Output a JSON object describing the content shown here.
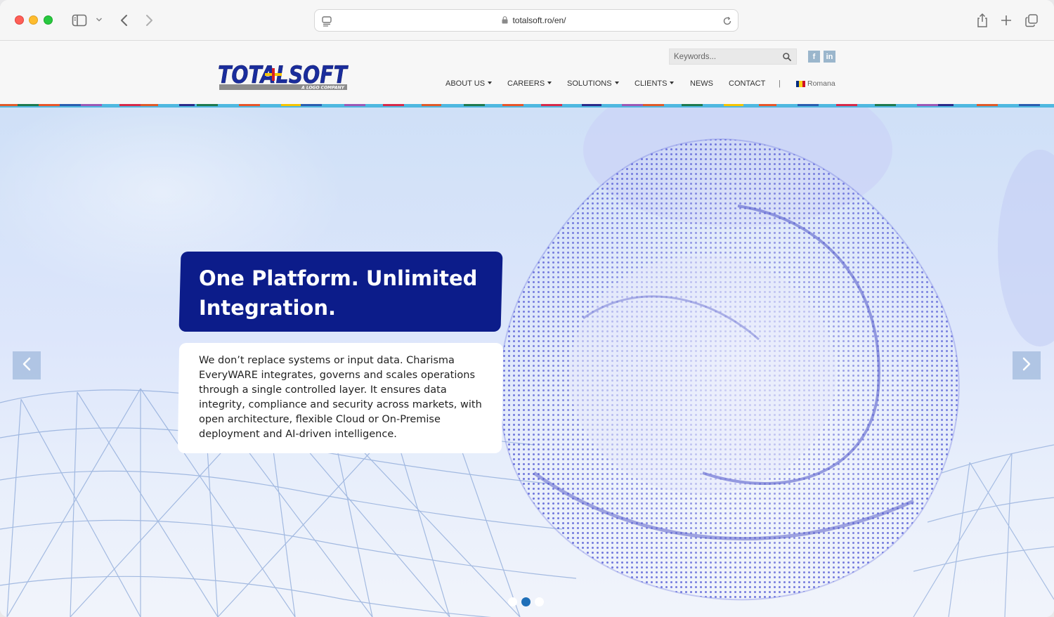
{
  "browser": {
    "url": "totalsoft.ro/en/"
  },
  "header": {
    "logo_text": "TOTALSOFT",
    "logo_tagline": "A LOGO COMPANY",
    "search_placeholder": "Keywords...",
    "social": {
      "facebook": "f",
      "linkedin": "in"
    },
    "nav": [
      {
        "label": "ABOUT US",
        "dropdown": true
      },
      {
        "label": "CAREERS",
        "dropdown": true
      },
      {
        "label": "SOLUTIONS",
        "dropdown": true
      },
      {
        "label": "CLIENTS",
        "dropdown": true
      },
      {
        "label": "NEWS",
        "dropdown": false
      },
      {
        "label": "CONTACT",
        "dropdown": false
      }
    ],
    "separator": "|",
    "language": "Romana"
  },
  "hero": {
    "title": "One Platform. Unlimited Integration.",
    "description": "We don’t replace systems or input data. Charisma EveryWARE integrates, governs and scales operations through a single controlled layer. It ensures data integrity, compliance and security across markets, with open architecture, flexible Cloud or On-Premise deployment and AI-driven intelligence.",
    "slides_total": 3,
    "active_slide": 2
  },
  "colors": {
    "brand_navy": "#0c1c8a",
    "accent_blue": "#1f6fb8",
    "logo_blue": "#1a2d9c",
    "logo_yellow": "#f6c400",
    "logo_red": "#d61f26"
  }
}
